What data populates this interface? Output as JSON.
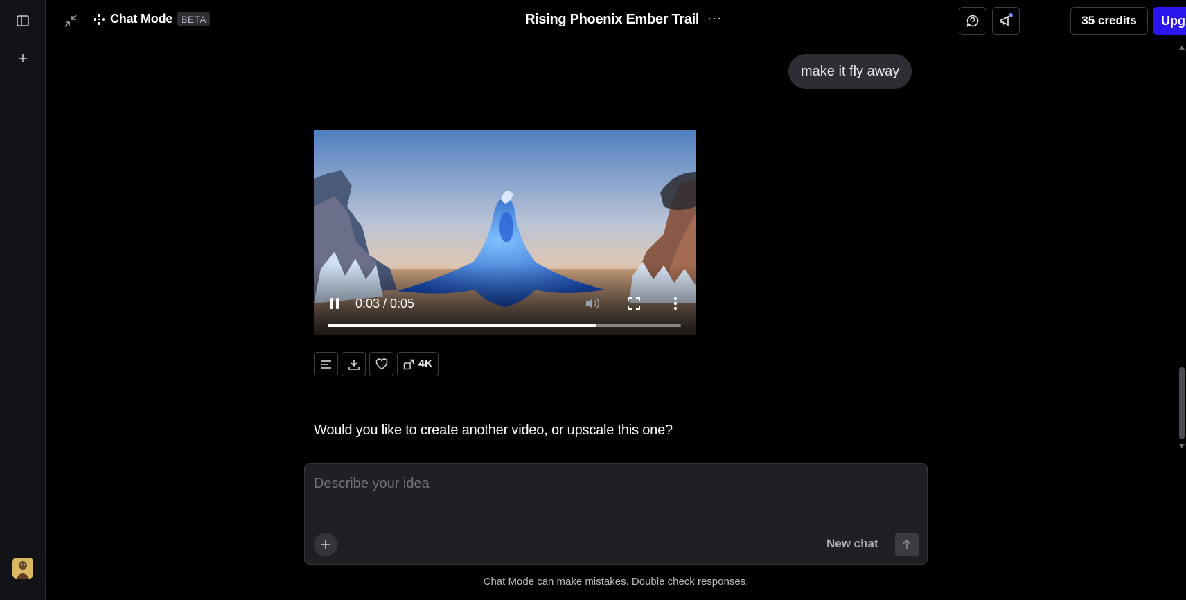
{
  "rail": {
    "toggle_icon": "sidebar-toggle-icon",
    "new_icon": "plus-icon",
    "avatar_icon": "user-avatar"
  },
  "header": {
    "mode_label": "Chat Mode",
    "beta_badge": "BETA",
    "title": "Rising Phoenix Ember Trail",
    "title_menu": "···",
    "credits": "35 credits",
    "upgrade": "Upgrade",
    "colors": {
      "upgrade": "#2b16f0"
    }
  },
  "conversation": {
    "user_message": "make it fly away",
    "video": {
      "time": "0:03 / 0:05",
      "progress": 0.76
    },
    "actions": {
      "upscale_label": "4K"
    },
    "assistant_message": "Would you like to create another video, or upscale this one?"
  },
  "composer": {
    "placeholder": "Describe your idea",
    "value": "",
    "new_chat": "New chat"
  },
  "footer": {
    "disclaimer": "Chat Mode can make mistakes. Double check responses."
  }
}
